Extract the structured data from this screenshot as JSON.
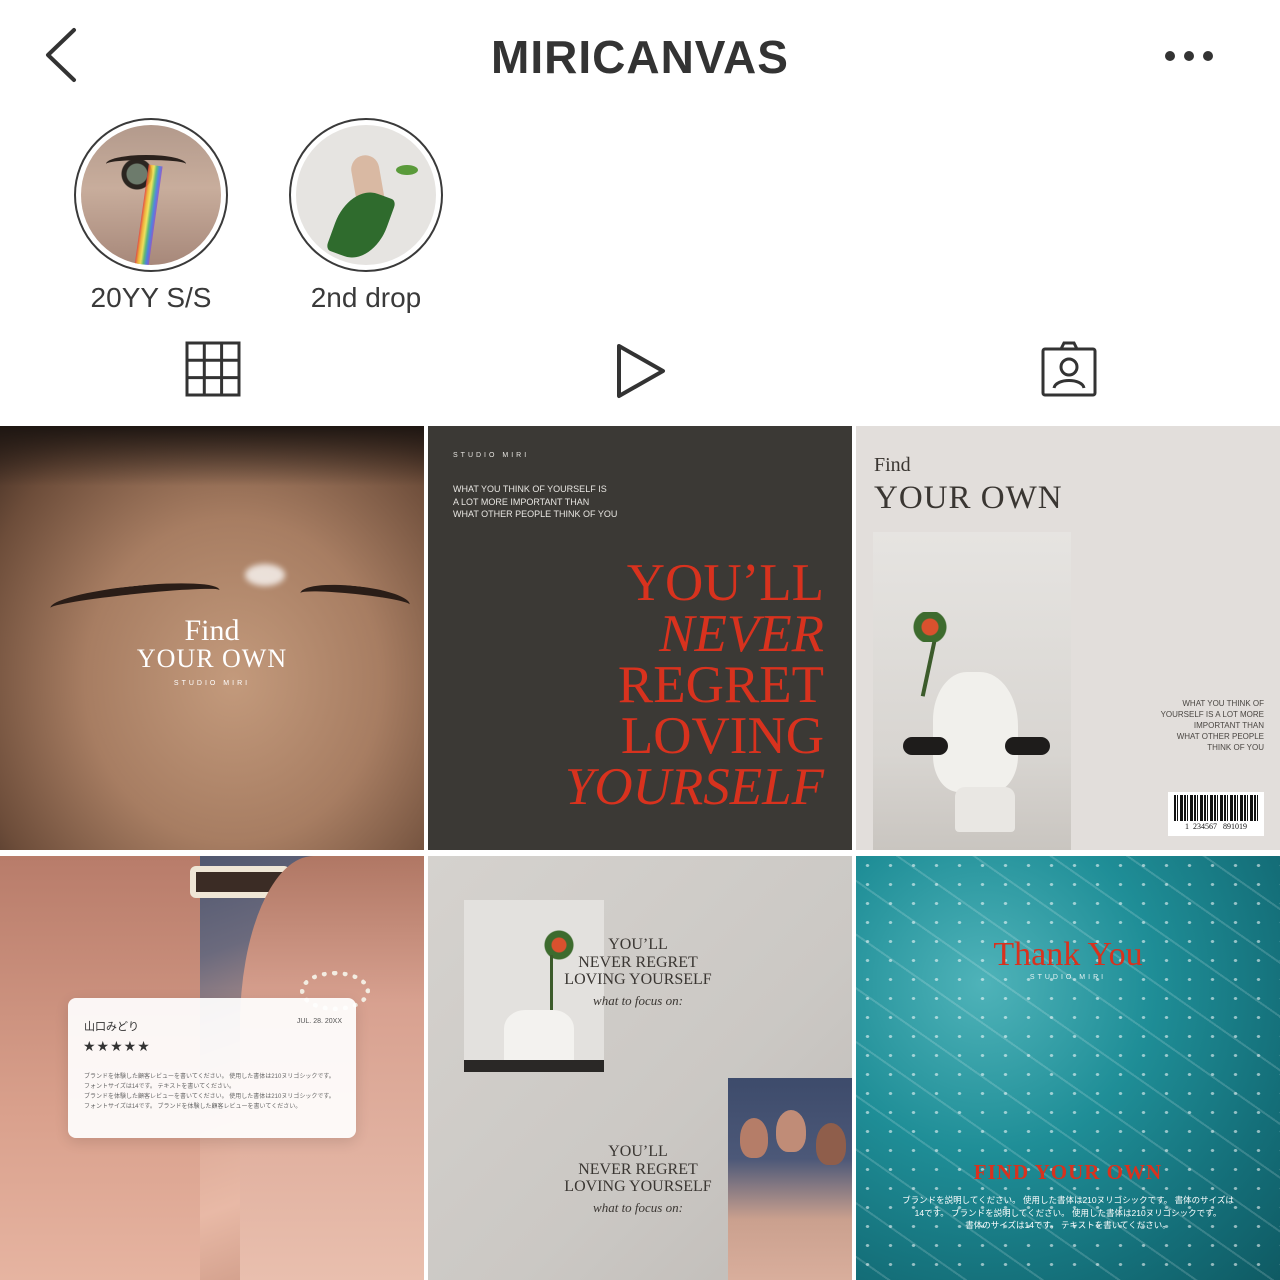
{
  "header": {
    "title": "MIRICANVAS"
  },
  "highlights": [
    {
      "label": "20YY S/S"
    },
    {
      "label": "2nd drop"
    }
  ],
  "posts": {
    "p1": {
      "title_small": "Find",
      "title_big": "YOUR OWN",
      "brand": "STUDIO MIRI"
    },
    "p2": {
      "brand": "STUDIO MIRI",
      "quote": [
        "WHAT YOU THINK OF YOURSELF IS",
        "A LOT MORE IMPORTANT THAN",
        "WHAT OTHER PEOPLE THINK OF YOU"
      ],
      "headline": [
        "YOU’LL",
        "NEVER",
        "REGRET",
        "LOVING",
        "YOURSELF"
      ]
    },
    "p3": {
      "title_small": "Find",
      "title_big": "YOUR OWN",
      "quote": [
        "WHAT YOU THINK OF",
        "YOURSELF IS A LOT MORE",
        "IMPORTANT THAN",
        "WHAT OTHER PEOPLE",
        "THINK OF YOU"
      ],
      "barcode_number": "1  234567   891019"
    },
    "p4": {
      "name": "山口みどり",
      "date": "JUL. 28. 20XX",
      "stars": "★★★★★",
      "review": [
        "ブランドを体験した顧客レビューを書いてください。 使用した書体は210ヌリゴシックです。",
        "フォントサイズは14です。 テキストを書いてください。",
        "ブランドを体験した顧客レビューを書いてください。 使用した書体は210ヌリゴシックです。",
        "フォントサイズは14です。 ブランドを体験した顧客レビューを書いてください。"
      ]
    },
    "p5": {
      "block1": [
        "YOU’LL",
        "NEVER REGRET",
        "LOVING YOURSELF"
      ],
      "block1_sub": "what to focus on:",
      "block2": [
        "YOU’LL",
        "NEVER REGRET",
        "LOVING YOURSELF"
      ],
      "block2_sub": "what to focus on:"
    },
    "p6": {
      "title": "Thank You",
      "brand": "STUDIO MIRI",
      "subtitle": "FIND YOUR OWN",
      "body": [
        "ブランドを説明してください。 使用した書体は210ヌリゴシックです。 書体のサイズは",
        "14です。 ブランドを説明してください。 使用した書体は210ヌリゴシックです。",
        "書体のサイズは14です。 テキストを書いてください。"
      ]
    }
  },
  "colors": {
    "accent_red": "#d8321e",
    "dark_bg": "#3b3935",
    "teal": "#1f8e97",
    "beige": "#e2dedb"
  }
}
